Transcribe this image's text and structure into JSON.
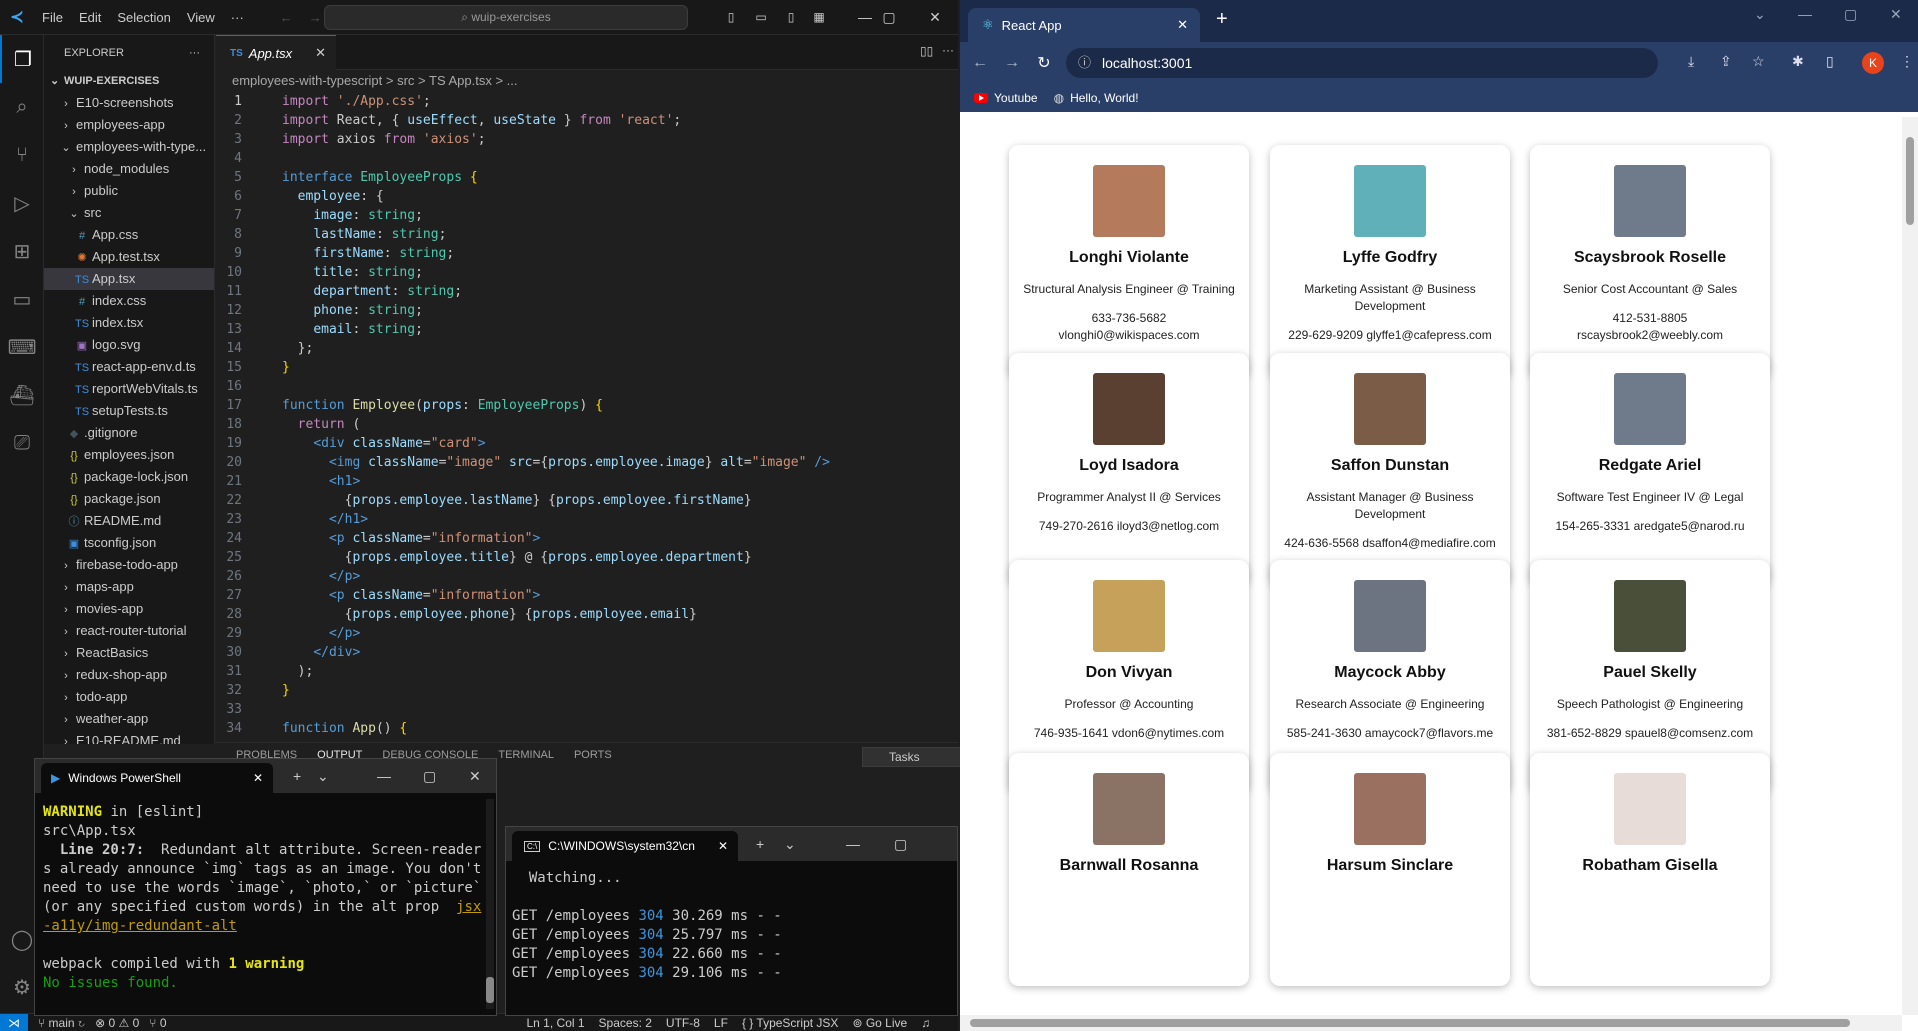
{
  "vscode": {
    "menu": [
      "File",
      "Edit",
      "Selection",
      "View",
      "···"
    ],
    "search": "⌕ wuip-exercises",
    "explorer": {
      "title": "EXPLORER",
      "root": "WUIP-EXERCISES",
      "items": [
        {
          "label": "E10-screenshots",
          "depth": 1,
          "kind": "folder"
        },
        {
          "label": "employees-app",
          "depth": 1,
          "kind": "folder"
        },
        {
          "label": "employees-with-type...",
          "depth": 1,
          "kind": "folder-open"
        },
        {
          "label": "node_modules",
          "depth": 2,
          "kind": "folder"
        },
        {
          "label": "public",
          "depth": 2,
          "kind": "folder"
        },
        {
          "label": "src",
          "depth": 2,
          "kind": "folder-open"
        },
        {
          "label": "App.css",
          "depth": 3,
          "kind": "css"
        },
        {
          "label": "App.test.tsx",
          "depth": 3,
          "kind": "test"
        },
        {
          "label": "App.tsx",
          "depth": 3,
          "kind": "ts",
          "selected": true
        },
        {
          "label": "index.css",
          "depth": 3,
          "kind": "css"
        },
        {
          "label": "index.tsx",
          "depth": 3,
          "kind": "ts"
        },
        {
          "label": "logo.svg",
          "depth": 3,
          "kind": "svg"
        },
        {
          "label": "react-app-env.d.ts",
          "depth": 3,
          "kind": "ts"
        },
        {
          "label": "reportWebVitals.ts",
          "depth": 3,
          "kind": "ts"
        },
        {
          "label": "setupTests.ts",
          "depth": 3,
          "kind": "ts"
        },
        {
          "label": ".gitignore",
          "depth": 2,
          "kind": "git"
        },
        {
          "label": "employees.json",
          "depth": 2,
          "kind": "json"
        },
        {
          "label": "package-lock.json",
          "depth": 2,
          "kind": "json"
        },
        {
          "label": "package.json",
          "depth": 2,
          "kind": "json"
        },
        {
          "label": "README.md",
          "depth": 2,
          "kind": "info"
        },
        {
          "label": "tsconfig.json",
          "depth": 2,
          "kind": "tsconfig"
        },
        {
          "label": "firebase-todo-app",
          "depth": 1,
          "kind": "folder"
        },
        {
          "label": "maps-app",
          "depth": 1,
          "kind": "folder"
        },
        {
          "label": "movies-app",
          "depth": 1,
          "kind": "folder"
        },
        {
          "label": "react-router-tutorial",
          "depth": 1,
          "kind": "folder"
        },
        {
          "label": "ReactBasics",
          "depth": 1,
          "kind": "folder"
        },
        {
          "label": "redux-shop-app",
          "depth": 1,
          "kind": "folder"
        },
        {
          "label": "todo-app",
          "depth": 1,
          "kind": "folder"
        },
        {
          "label": "weather-app",
          "depth": 1,
          "kind": "folder"
        },
        {
          "label": "E10-README.md",
          "depth": 1,
          "kind": "folder"
        }
      ]
    },
    "tab": {
      "label": "App.tsx",
      "lang": "TS"
    },
    "breadcrumb": "employees-with-typescript  >  src  >  TS  App.tsx  >  ...",
    "code": [
      "<span class='kc'>import</span> <span class='st'>'./App.css'</span>;",
      "<span class='kc'>import</span> React, { <span class='pr'>useEffect</span>, <span class='pr'>useState</span> } <span class='kc'>from</span> <span class='st'>'react'</span>;",
      "<span class='kc'>import</span> axios <span class='kc'>from</span> <span class='st'>'axios'</span>;",
      "",
      "<span class='kw'>interface</span> <span class='ty'>EmployeeProps</span> <span class='br'>{</span>",
      "  <span class='pr'>employee</span>: {",
      "    <span class='pr'>image</span>: <span class='ty'>string</span>;",
      "    <span class='pr'>lastName</span>: <span class='ty'>string</span>;",
      "    <span class='pr'>firstName</span>: <span class='ty'>string</span>;",
      "    <span class='pr'>title</span>: <span class='ty'>string</span>;",
      "    <span class='pr'>department</span>: <span class='ty'>string</span>;",
      "    <span class='pr'>phone</span>: <span class='ty'>string</span>;",
      "    <span class='pr'>email</span>: <span class='ty'>string</span>;",
      "  };",
      "<span class='br'>}</span>",
      "",
      "<span class='kw'>function</span> <span class='fn'>Employee</span>(<span class='pr'>props</span>: <span class='ty'>EmployeeProps</span>) <span class='br'>{</span>",
      "  <span class='kc'>return</span> (",
      "    <span class='tg'>&lt;div</span> <span class='at'>className</span>=<span class='st'>\"card\"</span><span class='tg'>&gt;</span>",
      "      <span class='tg'>&lt;img</span> <span class='at'>className</span>=<span class='st'>\"image\"</span> <span class='at'>src</span>={<span class='pr'>props.employee.image</span>} <span class='at'>alt</span>=<span class='st'>\"image\"</span> <span class='tg'>/&gt;</span>",
      "      <span class='tg'>&lt;h1&gt;</span>",
      "        {<span class='pr'>props.employee.lastName</span>} {<span class='pr'>props.employee.firstName</span>}",
      "      <span class='tg'>&lt;/h1&gt;</span>",
      "      <span class='tg'>&lt;p</span> <span class='at'>className</span>=<span class='st'>\"information\"</span><span class='tg'>&gt;</span>",
      "        {<span class='pr'>props.employee.title</span>} @ {<span class='pr'>props.employee.department</span>}",
      "      <span class='tg'>&lt;/p&gt;</span>",
      "      <span class='tg'>&lt;p</span> <span class='at'>className</span>=<span class='st'>\"information\"</span><span class='tg'>&gt;</span>",
      "        {<span class='pr'>props.employee.phone</span>} {<span class='pr'>props.employee.email</span>}",
      "      <span class='tg'>&lt;/p&gt;</span>",
      "    <span class='tg'>&lt;/div&gt;</span>",
      "  );",
      "<span class='br'>}</span>",
      "",
      "<span class='kw'>function</span> <span class='fn'>App</span>() <span class='br'>{</span>"
    ],
    "panel_tabs": [
      "PROBLEMS",
      "OUTPUT",
      "DEBUG CONSOLE",
      "TERMINAL",
      "PORTS"
    ],
    "tasks": "Tasks",
    "status": {
      "branch": "main",
      "errors": "⊗ 0 ⚠ 0",
      "ports": "⑂ 0",
      "position": "Ln 1, Col 1",
      "spaces": "Spaces: 2",
      "encoding": "UTF-8",
      "eol": "LF",
      "lang": "{ } TypeScript JSX",
      "golive": "Go Live"
    }
  },
  "powershell": {
    "title": "Windows PowerShell",
    "lines": [
      "<span class='yw'>WARNING</span> in [eslint]",
      "src\\App.tsx",
      "  <b>Line 20:7:</b>  Redundant alt attribute. Screen-readers already announce `img` tags as an image. You don't need to use the words `image`, `photo,` or `picture` (or any specified custom words) in the alt prop  <span class='lk'>jsx-a11y/img-redundant-alt</span>",
      "",
      "webpack compiled with <span class='yw'>1 warning</span>",
      "<span class='gr'>No issues found.</span>"
    ]
  },
  "cmd": {
    "title": "C:\\WINDOWS\\system32\\cn",
    "lines": [
      "  Watching...",
      "",
      "GET /employees <span class='cy'>304</span> 30.269 ms - -",
      "GET /employees <span class='cy'>304</span> 25.797 ms - -",
      "GET /employees <span class='cy'>304</span> 22.660 ms - -",
      "GET /employees <span class='cy'>304</span> 29.106 ms - -"
    ]
  },
  "chrome": {
    "tab_title": "React App",
    "url": "localhost:3001",
    "avatar": "K",
    "bookmarks": [
      "Youtube",
      "Hello, World!"
    ],
    "employees": [
      {
        "name": "Longhi Violante",
        "info": "Structural Analysis Engineer @ Training",
        "contact": "633-736-5682 vlonghi0@wikispaces.com",
        "color": "#b47a5c"
      },
      {
        "name": "Lyffe Godfry",
        "info": "Marketing Assistant @ Business Development",
        "contact": "229-629-9209 glyffe1@cafepress.com",
        "color": "#5fb0b8"
      },
      {
        "name": "Scaysbrook Roselle",
        "info": "Senior Cost Accountant @ Sales",
        "contact": "412-531-8805 rscaysbrook2@weebly.com",
        "color": "#6f7a8a"
      },
      {
        "name": "Loyd Isadora",
        "info": "Programmer Analyst II @ Services",
        "contact": "749-270-2616 iloyd3@netlog.com",
        "color": "#5a4030"
      },
      {
        "name": "Saffon Dunstan",
        "info": "Assistant Manager @ Business Development",
        "contact": "424-636-5568 dsaffon4@mediafire.com",
        "color": "#7b5d47"
      },
      {
        "name": "Redgate Ariel",
        "info": "Software Test Engineer IV @ Legal",
        "contact": "154-265-3331 aredgate5@narod.ru",
        "color": "#6f7a8a"
      },
      {
        "name": "Don Vivyan",
        "info": "Professor @ Accounting",
        "contact": "746-935-1641 vdon6@nytimes.com",
        "color": "#c6a15a"
      },
      {
        "name": "Maycock Abby",
        "info": "Research Associate @ Engineering",
        "contact": "585-241-3630 amaycock7@flavors.me",
        "color": "#6c7482"
      },
      {
        "name": "Pauel Skelly",
        "info": "Speech Pathologist @ Engineering",
        "contact": "381-652-8829 spauel8@comsenz.com",
        "color": "#4a4f3a"
      },
      {
        "name": "Barnwall Rosanna",
        "info": "",
        "contact": "",
        "color": "#8a7264"
      },
      {
        "name": "Harsum Sinclare",
        "info": "",
        "contact": "",
        "color": "#9a7060"
      },
      {
        "name": "Robatham Gisella",
        "info": "",
        "contact": "",
        "color": "#e8dcd8"
      }
    ]
  }
}
